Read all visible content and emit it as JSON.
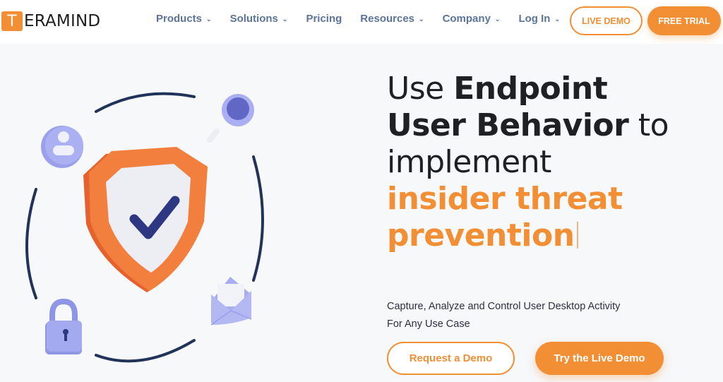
{
  "brand": {
    "logo_letter": "T",
    "logo_rest": "ERAMIND",
    "accent": "#f28f34",
    "nav_color": "#5b7499"
  },
  "nav": {
    "items": [
      {
        "label": "Products",
        "dropdown": true
      },
      {
        "label": "Solutions",
        "dropdown": true
      },
      {
        "label": "Pricing",
        "dropdown": false
      },
      {
        "label": "Resources",
        "dropdown": true
      },
      {
        "label": "Company",
        "dropdown": true
      },
      {
        "label": "Log In",
        "dropdown": true
      }
    ],
    "chevron": "⌄",
    "live_demo": "LIVE DEMO",
    "free_trial": "FREE TRIAL"
  },
  "hero": {
    "line1_light": "Use ",
    "line1_bold": "Endpoint",
    "line2_bold": "User Behavior",
    "line2_light": " to",
    "line3": "implement",
    "line4": "insider threat",
    "line5": "prevention",
    "subtitle_line1": "Capture, Analyze and Control User Desktop Activity",
    "subtitle_line2": "For Any Use Case",
    "request_demo": "Request a Demo",
    "try_live_demo": "Try the Live Demo"
  },
  "illustration": {
    "icons": [
      "shield-check-icon",
      "user-icon",
      "magnifier-icon",
      "padlock-icon",
      "envelope-icon"
    ]
  }
}
